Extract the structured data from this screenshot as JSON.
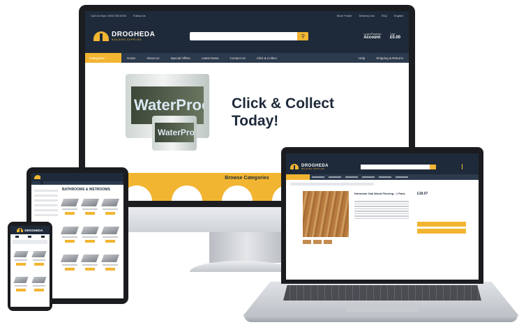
{
  "monitor": {
    "topbar_left": [
      "Call Us Now: 0000 000 0000",
      "Follow Us"
    ],
    "topbar_right": [
      "Store Finder",
      "Delivery Info",
      "FAQ",
      "English"
    ],
    "brand_name": "DROGHEDA",
    "brand_sub": "BUILDING SUPPLIES",
    "account_small": "Login/Register",
    "account_label": "Account",
    "cart_small": "Cart",
    "cart_total": "£0.00",
    "nav_categories": "Categories",
    "nav_items": [
      "Home",
      "About Us",
      "Special Offers",
      "Latest News",
      "Contact Us",
      "Click & Collect"
    ],
    "nav_right": [
      "Help",
      "Shipping & Returns"
    ],
    "hero_line1": "Click & Collect",
    "hero_line2": "Today!",
    "bucket_text": "WaterProof",
    "browse_title": "Browse Categories"
  },
  "tablet": {
    "heading": "BATHROOMS & WETROOMS"
  },
  "phone": {
    "brand_name": "DROGHEDA"
  },
  "laptop": {
    "brand_name": "DROGHEDA",
    "brand_sub": "BUILDING SUPPLIES",
    "product_title": "Homestar Oak Wood Flooring - 1 Pack",
    "price": "£18.07"
  },
  "colors": {
    "navy": "#1e2a3a",
    "yellow": "#f2b531"
  }
}
